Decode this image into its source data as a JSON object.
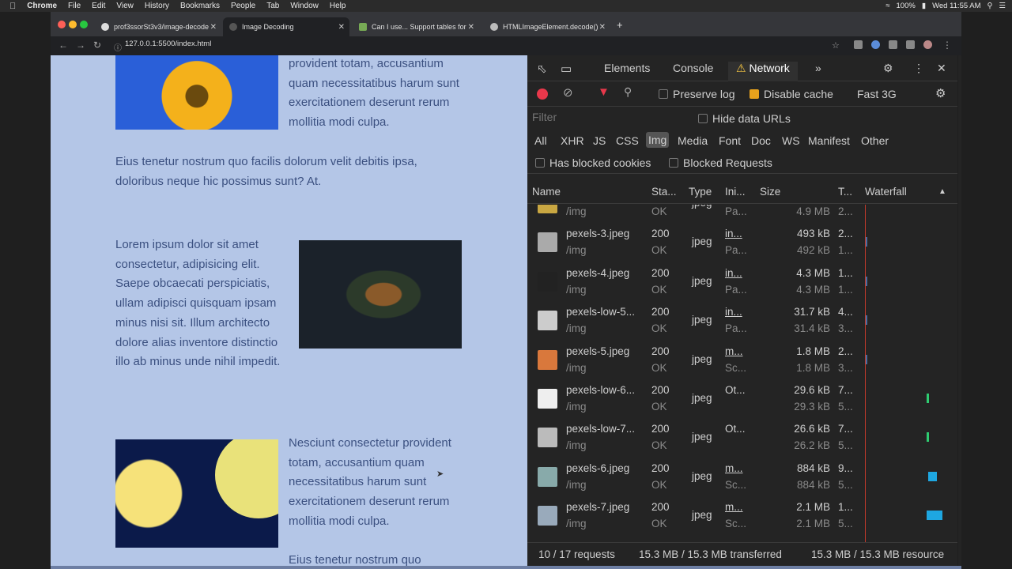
{
  "menubar": {
    "app": "Chrome",
    "items": [
      "File",
      "Edit",
      "View",
      "History",
      "Bookmarks",
      "People",
      "Tab",
      "Window",
      "Help"
    ],
    "battery": "100%",
    "datetime": "Wed 11:55 AM"
  },
  "browser": {
    "tabs": [
      {
        "label": "prof3ssorSt3v3/image-decode"
      },
      {
        "label": "Image Decoding"
      },
      {
        "label": "Can I use... Support tables for"
      },
      {
        "label": "HTMLImageElement.decode()"
      }
    ],
    "url": "127.0.0.1:5500/index.html",
    "new_tab": "+"
  },
  "page": {
    "block1_right_text": "provident totam, accusantium quam necessitatibus harum sunt exercitationem deserunt rerum mollitia modi culpa.",
    "block1_tail": "Eius tenetur nostrum quo facilis dolorum velit debitis ipsa, doloribus neque hic possimus sunt? At.",
    "block2_text": "Lorem ipsum dolor sit amet consectetur, adipisicing elit. Saepe obcaecati perspiciatis, ullam adipisci quisquam ipsam minus nisi sit. Illum architecto dolore alias inventore distinctio illo ab minus unde nihil impedit.",
    "block3_text": "Nesciunt consectetur provident totam, accusantium quam necessitatibus harum sunt exercitationem deserunt rerum mollitia modi culpa.",
    "block3_tail": "Eius tenetur nostrum quo"
  },
  "devtools": {
    "tabs": {
      "elements": "Elements",
      "console": "Console",
      "network": "Network"
    },
    "toolbar": {
      "preserve_log": "Preserve log",
      "disable_cache": "Disable cache",
      "throttle": "Fast 3G"
    },
    "filter_placeholder": "Filter",
    "hide_data_urls": "Hide data URLs",
    "types": [
      "All",
      "XHR",
      "JS",
      "CSS",
      "Img",
      "Media",
      "Font",
      "Doc",
      "WS",
      "Manifest",
      "Other"
    ],
    "has_blocked_cookies": "Has blocked cookies",
    "blocked_requests": "Blocked Requests",
    "columns": {
      "name": "Name",
      "status": "Sta...",
      "type": "Type",
      "initiator": "Ini...",
      "size": "Size",
      "time": "T...",
      "waterfall": "Waterfall"
    },
    "rows": [
      {
        "name": "",
        "path": "/img",
        "status": "",
        "status2": "OK",
        "type": "jpeg",
        "init": "",
        "init2": "Pa...",
        "size": "",
        "size2": "4.9 MB",
        "time": "",
        "time2": "2..."
      },
      {
        "name": "pexels-3.jpeg",
        "path": "/img",
        "status": "200",
        "status2": "OK",
        "type": "jpeg",
        "init": "in...",
        "init2": "Pa...",
        "size": "493 kB",
        "size2": "492 kB",
        "time": "2...",
        "time2": "1..."
      },
      {
        "name": "pexels-4.jpeg",
        "path": "/img",
        "status": "200",
        "status2": "OK",
        "type": "jpeg",
        "init": "in...",
        "init2": "Pa...",
        "size": "4.3 MB",
        "size2": "4.3 MB",
        "time": "1...",
        "time2": "1..."
      },
      {
        "name": "pexels-low-5...",
        "path": "/img",
        "status": "200",
        "status2": "OK",
        "type": "jpeg",
        "init": "in...",
        "init2": "Pa...",
        "size": "31.7 kB",
        "size2": "31.4 kB",
        "time": "4...",
        "time2": "3..."
      },
      {
        "name": "pexels-5.jpeg",
        "path": "/img",
        "status": "200",
        "status2": "OK",
        "type": "jpeg",
        "init": "m...",
        "init2": "Sc...",
        "size": "1.8 MB",
        "size2": "1.8 MB",
        "time": "2...",
        "time2": "3..."
      },
      {
        "name": "pexels-low-6...",
        "path": "/img",
        "status": "200",
        "status2": "OK",
        "type": "jpeg",
        "init": "Ot...",
        "init2": "",
        "size": "29.6 kB",
        "size2": "29.3 kB",
        "time": "7...",
        "time2": "5..."
      },
      {
        "name": "pexels-low-7...",
        "path": "/img",
        "status": "200",
        "status2": "OK",
        "type": "jpeg",
        "init": "Ot...",
        "init2": "",
        "size": "26.6 kB",
        "size2": "26.2 kB",
        "time": "7...",
        "time2": "5..."
      },
      {
        "name": "pexels-6.jpeg",
        "path": "/img",
        "status": "200",
        "status2": "OK",
        "type": "jpeg",
        "init": "m...",
        "init2": "Sc...",
        "size": "884 kB",
        "size2": "884 kB",
        "time": "9...",
        "time2": "5..."
      },
      {
        "name": "pexels-7.jpeg",
        "path": "/img",
        "status": "200",
        "status2": "OK",
        "type": "jpeg",
        "init": "m...",
        "init2": "Sc...",
        "size": "2.1 MB",
        "size2": "2.1 MB",
        "time": "1...",
        "time2": "5..."
      }
    ],
    "status": {
      "requests": "10 / 17 requests",
      "transferred": "15.3 MB / 15.3 MB transferred",
      "resources": "15.3 MB / 15.3 MB resource"
    }
  }
}
